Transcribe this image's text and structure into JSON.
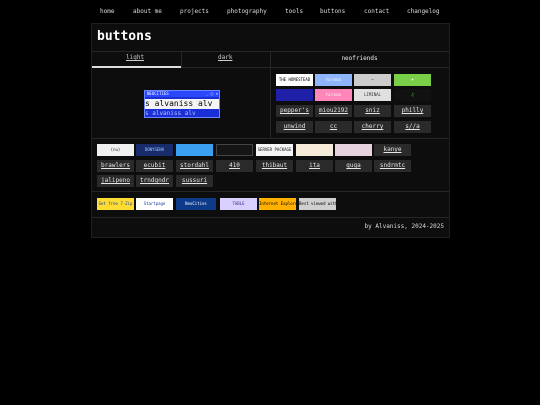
{
  "nav": {
    "items": [
      {
        "label": "home"
      },
      {
        "label": "about me"
      },
      {
        "label": "projects"
      },
      {
        "label": "photography"
      },
      {
        "label": "tools"
      },
      {
        "label": "buttons"
      },
      {
        "label": "contact"
      },
      {
        "label": "changelog"
      }
    ]
  },
  "page": {
    "title": "buttons",
    "tabs": [
      {
        "label": "light"
      },
      {
        "label": "dark"
      }
    ],
    "neofriends_title": "neofriends",
    "footer": "by Alvaniss, 2024-2025"
  },
  "my_button": {
    "titlebar": "NEOCITIES",
    "controls": "_ ▢ ✕",
    "marquee": "s alvaniss alv",
    "subtext": "s alvaniss alv"
  },
  "neofriends": {
    "image_buttons": [
      {
        "label": "THE HOMESTEAD",
        "bg": "#ffffff",
        "fg": "#000000"
      },
      {
        "label": "hirosa",
        "bg": "#8fb5ff",
        "fg": "#ffffff"
      },
      {
        "label": "~",
        "bg": "#cccccc",
        "fg": "#333333"
      },
      {
        "label": "♦",
        "bg": "#7acf49",
        "fg": "#ffffff"
      },
      {
        "label": "",
        "bg": "#1f1fa8",
        "fg": "#ffffff"
      },
      {
        "label": "hirosa",
        "bg": "#ff86b8",
        "fg": "#ffffff"
      },
      {
        "label": "LIMINAL",
        "bg": "#e0e0e0",
        "fg": "#333333"
      },
      {
        "label": "♫",
        "bg": "#111111",
        "fg": "#55ff55"
      }
    ],
    "text_buttons": [
      {
        "label": "pepper's"
      },
      {
        "label": "miou2192"
      },
      {
        "label": "sniz"
      },
      {
        "label": "philly"
      },
      {
        "label": "unwind"
      },
      {
        "label": "cc"
      },
      {
        "label": "cherry"
      },
      {
        "label": "s//a"
      }
    ]
  },
  "others": {
    "row1_images": [
      {
        "label": "(nu)",
        "bg": "#f0f0f0",
        "fg": "#222222"
      },
      {
        "label": "DONYSENA",
        "bg": "#1a2b6b",
        "fg": "#8fd4ff"
      },
      {
        "label": "",
        "bg": "#3aa0f0",
        "fg": "#ffffff"
      },
      {
        "label": "",
        "bg": "#151515",
        "fg": "#eeeeee"
      },
      {
        "label": "SERVER PACKAGE",
        "bg": "#f5f5f5",
        "fg": "#111111"
      },
      {
        "label": "",
        "bg": "#f5ebd8",
        "fg": "#333333"
      },
      {
        "label": "",
        "bg": "#e6d2dc",
        "fg": "#884466"
      }
    ],
    "row1_text": {
      "label": "kanye"
    },
    "row2": [
      {
        "label": "brawlers"
      },
      {
        "label": "ecubit"
      },
      {
        "label": "stordahl"
      },
      {
        "label": "410"
      },
      {
        "label": "thibaut"
      },
      {
        "label": "ita"
      },
      {
        "label": "guga"
      },
      {
        "label": "sndrmtc"
      }
    ],
    "row3": [
      {
        "label": "jalipeno"
      },
      {
        "label": "trndgndr"
      },
      {
        "label": "sussuri"
      }
    ]
  },
  "small_buttons": [
    {
      "label": "Get free 7-Zip",
      "bg": "#ffdd33",
      "fg": "#1b3c9a"
    },
    {
      "label": "Startpage",
      "bg": "#ffffff",
      "fg": "#1b3c9a"
    },
    {
      "label": "NeoCities",
      "bg": "#0e3a8a",
      "fg": "#ffffff"
    },
    {
      "label": "TABLE",
      "bg": "#d9d0ff",
      "fg": "#442288"
    },
    {
      "label": "Internet Explorer",
      "bg": "#ffb000",
      "fg": "#000000"
    },
    {
      "label": "Best viewed with a free browser",
      "bg": "#cfcfcf",
      "fg": "#000000"
    }
  ]
}
